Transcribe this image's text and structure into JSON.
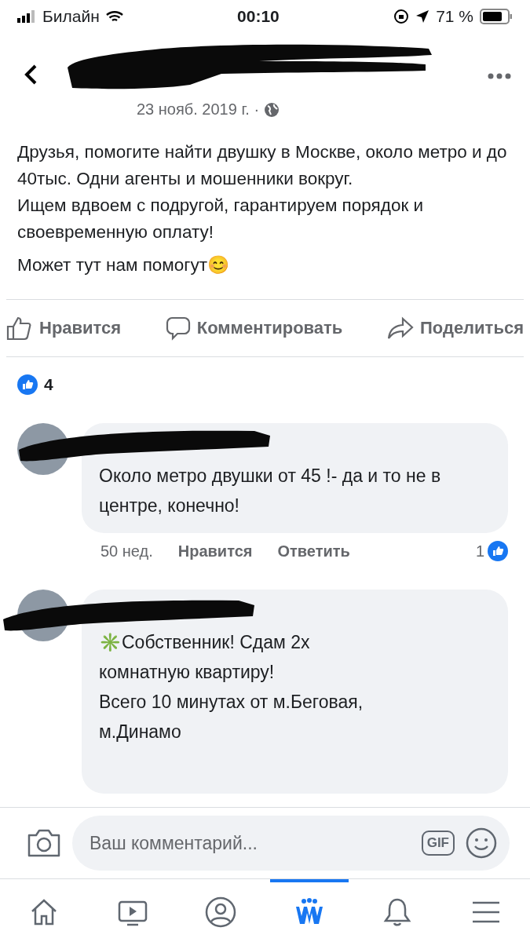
{
  "status_bar": {
    "carrier": "Билайн",
    "time": "00:10",
    "battery": "71 %"
  },
  "post": {
    "date": "23 нояб. 2019 г. ·",
    "paragraphs": [
      "Друзья, помогите найти двушку в Москве, около метро и до 40тыс. Одни агенты и мошенники вокруг.\nИщем вдвоем с подругой, гарантируем порядок и своевременную оплату!",
      "Может тут нам помогут😊"
    ],
    "actions": [
      {
        "kind": "like",
        "label": "Нравится"
      },
      {
        "kind": "comment",
        "label": "Комментировать"
      },
      {
        "kind": "share",
        "label": "Поделиться"
      }
    ],
    "reactions": "4"
  },
  "comments": [
    {
      "text": "Около метро двушки от 45 !- да и то не в центре, конечно!",
      "time": "50 нед.",
      "like": "Нравится",
      "reply": "Ответить",
      "reactions": "1"
    },
    {
      "text": "✳️Собственник! Сдам 2х\nкомнатную квартиру!\nВсего 10 минутах от м.Беговая,\nм.Динамо"
    }
  ],
  "composer": {
    "placeholder": "Ваш комментарий...",
    "gif": "GIF"
  },
  "nav": [
    {
      "kind": "home",
      "selected": false
    },
    {
      "kind": "video",
      "selected": false
    },
    {
      "kind": "profile",
      "selected": false
    },
    {
      "kind": "groups",
      "selected": true
    },
    {
      "kind": "notifications",
      "selected": false
    },
    {
      "kind": "menu",
      "selected": false
    }
  ]
}
